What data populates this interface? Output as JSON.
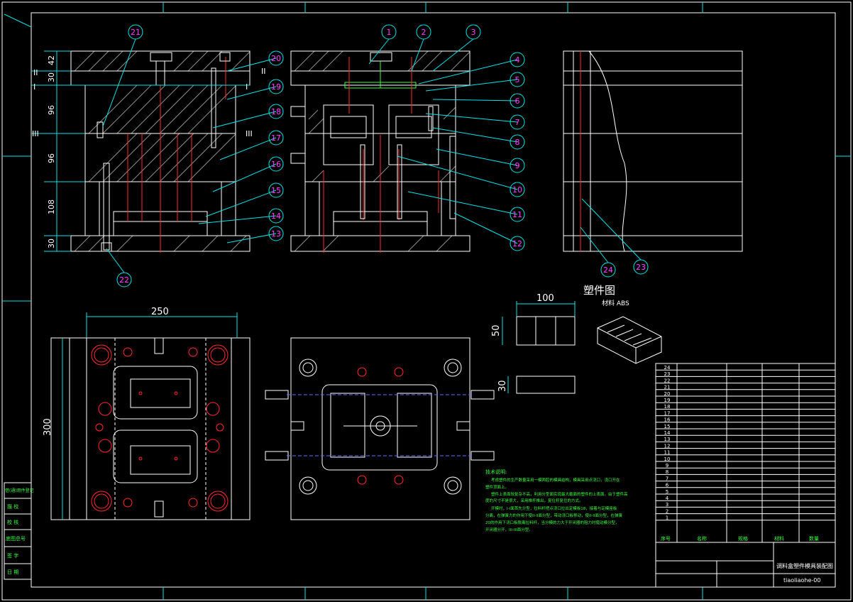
{
  "dimensions": {
    "h42": "42",
    "h30": "30",
    "h96a": "96",
    "h96b": "96",
    "h108": "108",
    "h30b": "30",
    "w250": "250",
    "h300": "300",
    "w100": "100",
    "h50": "50",
    "h30c": "30"
  },
  "sections": {
    "II_left": "II",
    "II_right": "II",
    "I_left": "I",
    "I_right": "I",
    "III_left": "III",
    "III_right": "III"
  },
  "balloons": [
    "21",
    "1",
    "2",
    "3",
    "20",
    "4",
    "5",
    "19",
    "6",
    "18",
    "7",
    "8",
    "17",
    "9",
    "16",
    "10",
    "15",
    "11",
    "14",
    "12",
    "13",
    "22",
    "24",
    "23"
  ],
  "part_drawing": {
    "title": "塑件图",
    "material": "材料 ABS"
  },
  "tech_notes": {
    "heading": "技术说明:",
    "line1": "考虑塑件的生产数量采用一模两腔的模具结构，模具采用点浇口，浇口开在",
    "line2": "塑件顶面上。",
    "line3": "塑件上表面较复杂不高，利用分型面实现最大截面的塑件的上表面，由于塑件高",
    "line4": "度的尺寸不是很大，采用推杆推出，复位杆复位的方式。",
    "line5": "开模时，I-I面首先分型，拉料杆把点浇口拉出定模板18，接着与定模座板",
    "line6": "分离，在弹簧力的作用下使II-II面分型，带动浇口板移动，使II-II面分型，在弹簧",
    "line7": "20的作用下浇口板脱离拉料杆，当分模的力大于开闭器的阻力时使动模分型，",
    "line8": "开闭器分开，III-III面分型。"
  },
  "bom": {
    "rows": [
      "24",
      "23",
      "22",
      "21",
      "20",
      "19",
      "18",
      "17",
      "16",
      "15",
      "14",
      "13",
      "12",
      "11",
      "10",
      "9",
      "8",
      "7",
      "6",
      "5",
      "4",
      "3",
      "2",
      "1"
    ],
    "col_num": "序号",
    "col_name": "名称",
    "col_spec": "规格",
    "col_material": "材料",
    "col_qty": "数量"
  },
  "title_block": {
    "title": "调料盒塑件模具装配图",
    "drawing_no": "tiaoliaohe-00"
  },
  "left_strip": [
    "借(通)用件登记",
    "描 校",
    "校 核",
    "底图总号",
    "签 字",
    "日 期"
  ]
}
